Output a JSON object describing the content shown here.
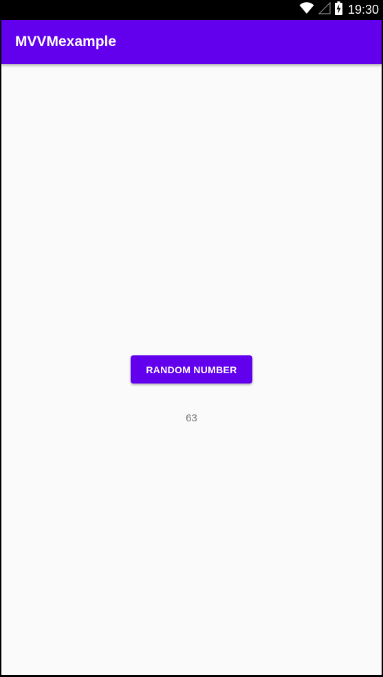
{
  "status_bar": {
    "time": "19:30",
    "icons": [
      "wifi-icon",
      "cell-signal-icon",
      "battery-charging-icon"
    ]
  },
  "app_bar": {
    "title": "MVVMexample",
    "color": "#6200ee"
  },
  "main": {
    "button_label": "RANDOM NUMBER",
    "number_value": "63"
  },
  "colors": {
    "accent": "#6200ee",
    "background": "#fafafa",
    "text_secondary": "#757575"
  }
}
